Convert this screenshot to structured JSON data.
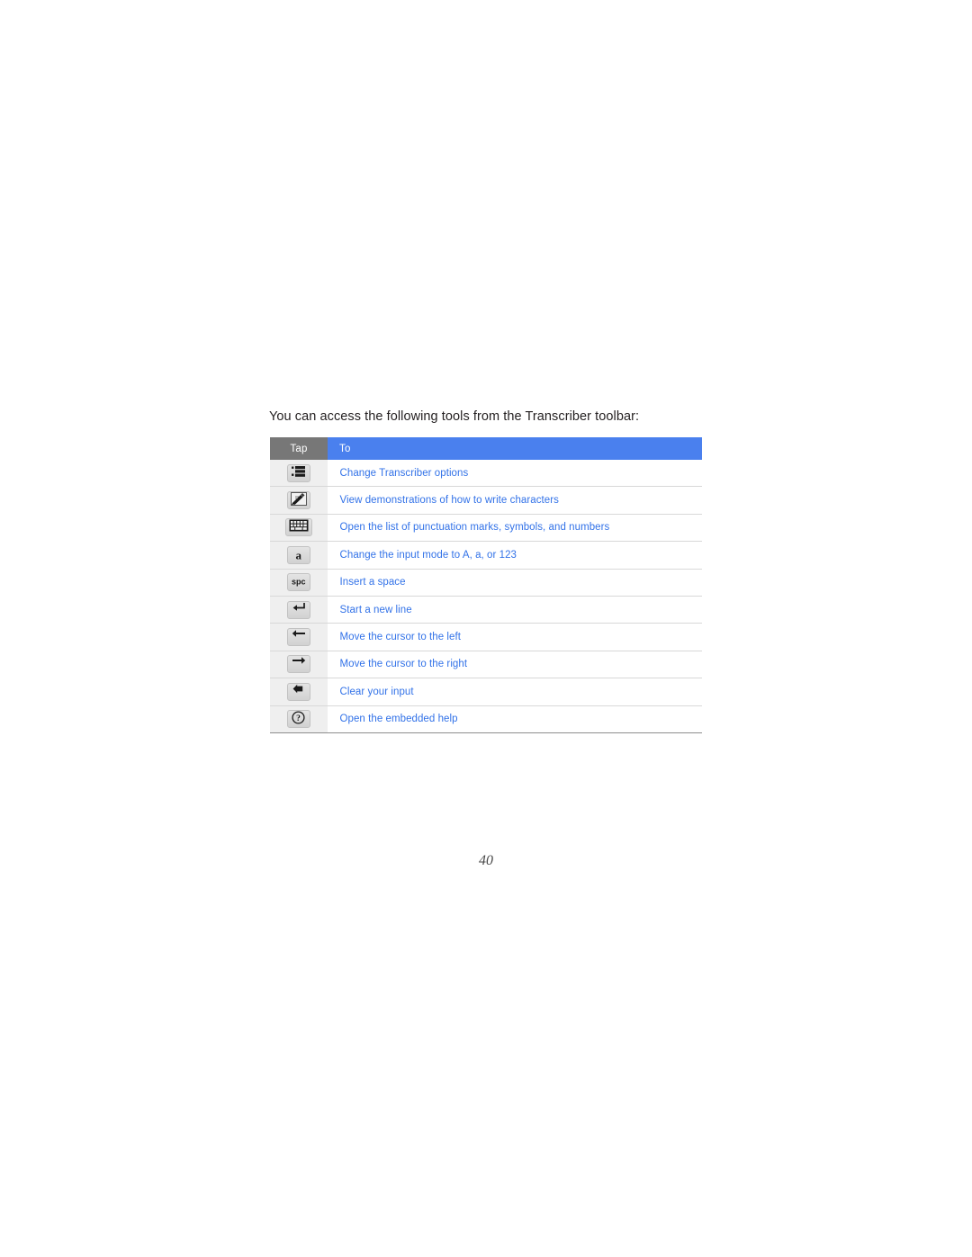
{
  "document": {
    "intro_text": "You can access the following tools from the Transcriber toolbar:",
    "page_number": "40"
  },
  "table": {
    "headers": {
      "tap": "Tap",
      "to": "To"
    },
    "colors": {
      "header_tap_bg": "#777777",
      "header_to_bg": "#4a80ee",
      "link_text": "#3272e8",
      "icon_cell_bg": "#efefef",
      "row_divider": "#d8d8d8"
    },
    "rows": [
      {
        "icon": "bulleted-list-icon",
        "label": "Change Transcriber options"
      },
      {
        "icon": "pen-demo-icon",
        "label": "View demonstrations of how to write characters"
      },
      {
        "icon": "keyboard-grid-icon",
        "label": "Open the list of punctuation marks, symbols, and numbers"
      },
      {
        "icon": "letter-a-icon",
        "label": "Change the input mode to A, a, or 123"
      },
      {
        "icon": "space-key-icon",
        "label": "Insert a space"
      },
      {
        "icon": "enter-key-icon",
        "label": "Start a new line"
      },
      {
        "icon": "arrow-left-icon",
        "label": "Move the cursor to the left"
      },
      {
        "icon": "arrow-right-icon",
        "label": "Move the cursor to the right"
      },
      {
        "icon": "backspace-icon",
        "label": "Clear your input"
      },
      {
        "icon": "help-question-icon",
        "label": "Open the embedded help"
      }
    ],
    "icon_glyphs": {
      "space-key-icon": "spc",
      "letter-a-icon": "a"
    }
  }
}
